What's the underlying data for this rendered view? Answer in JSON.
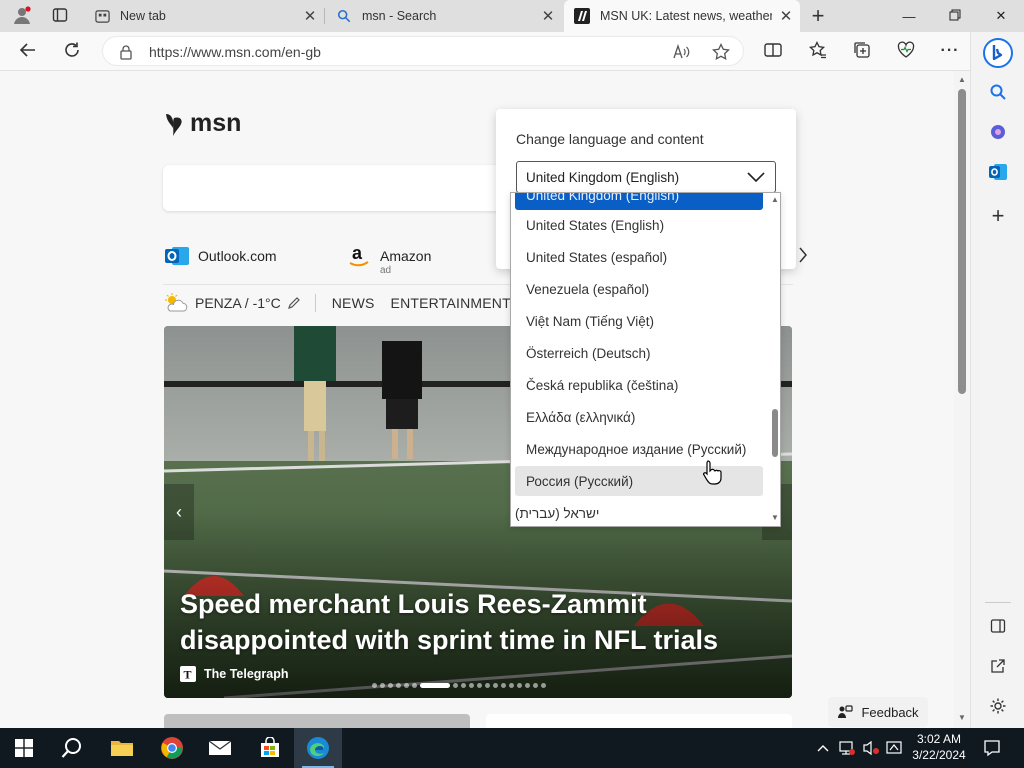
{
  "browser": {
    "tabs": [
      {
        "label": "New tab"
      },
      {
        "label": "msn - Search"
      },
      {
        "label": "MSN UK: Latest news, weather, H"
      }
    ],
    "url": "https://www.msn.com/en-gb"
  },
  "msn": {
    "logo_text": "msn",
    "quicklinks": [
      {
        "label": "Outlook.com",
        "sub": ""
      },
      {
        "label": "Amazon",
        "sub": "ad"
      }
    ],
    "weather": "PENZA / -1°C",
    "nav_items": [
      "NEWS",
      "ENTERTAINMENT"
    ],
    "hero": {
      "headline": "Speed merchant Louis Rees-Zammit disappointed with sprint time in NFL trials",
      "source": "The Telegraph"
    },
    "feedback": "Feedback"
  },
  "language_panel": {
    "title": "Change language and content",
    "selected": "United Kingdom (English)",
    "options": [
      "United Kingdom (English)",
      "United States (English)",
      "United States (español)",
      "Venezuela (español)",
      "Việt Nam (Tiếng Việt)",
      "Österreich (Deutsch)",
      "Česká republika (čeština)",
      "Ελλάδα (ελληνικά)",
      "Международное издание (Русский)",
      "Россия (Русский)",
      "ישראל (עברית)"
    ]
  },
  "taskbar": {
    "time": "3:02 AM",
    "date": "3/22/2024"
  },
  "colors": {
    "accent": "#0a5fc7",
    "taskbar": "#101820"
  }
}
